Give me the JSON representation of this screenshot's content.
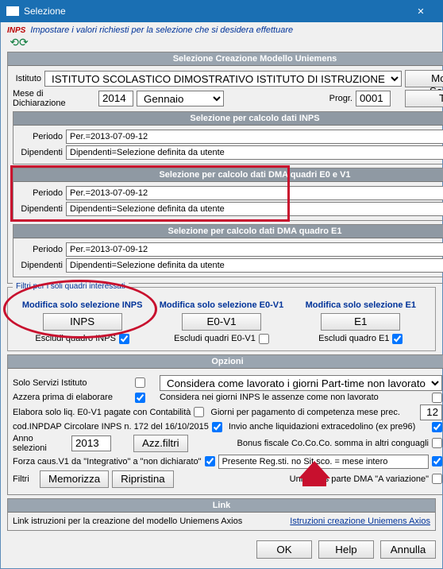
{
  "window": {
    "title": "Selezione"
  },
  "info": {
    "inps": "INPS",
    "text": "Impostare i valori richiesti per la selezione che si desidera effettuare"
  },
  "sec_creazione": {
    "header": "Selezione Creazione Modello Uniemens",
    "istituto_label": "Istituto",
    "istituto_value": "ISTITUTO SCOLASTICO DIMOSTRATIVO ISTITUTO DI ISTRUZIONE",
    "mod_sel_btn": "Modifica Selezioni",
    "mese_label": "Mese di Dichiarazione",
    "anno": "2014",
    "mese": "Gennaio",
    "progr_label": "Progr.",
    "progr": "0001",
    "tutte_btn": "Tutte"
  },
  "sec_inps": {
    "header": "Selezione per calcolo dati INPS",
    "periodo_label": "Periodo",
    "periodo_value": "Per.=2013-07-09-12",
    "dip_label": "Dipendenti",
    "dip_value": "Dipendenti=Selezione definita da utente"
  },
  "sec_e0v1": {
    "header": "Selezione per calcolo dati DMA quadri E0 e V1",
    "periodo_label": "Periodo",
    "periodo_value": "Per.=2013-07-09-12",
    "dip_label": "Dipendenti",
    "dip_value": "Dipendenti=Selezione definita da utente"
  },
  "sec_e1": {
    "header": "Selezione per calcolo dati DMA quadro E1",
    "periodo_label": "Periodo",
    "periodo_value": "Per.=2013-07-09-12",
    "dip_label": "Dipendenti",
    "dip_value": "Dipendenti=Selezione definita da utente"
  },
  "filtri": {
    "legend": "Filtri per i soli quadri interessati",
    "col1_head": "Modifica solo selezione INPS",
    "col1_btn": "INPS",
    "col1_excl": "Escludi quadro INPS",
    "col2_head": "Modifica solo selezione E0-V1",
    "col2_btn": "E0-V1",
    "col2_excl": "Escludi quadri E0-V1",
    "col3_head": "Modifica solo selezione E1",
    "col3_btn": "E1",
    "col3_excl": "Escludi quadro E1"
  },
  "opzioni": {
    "header": "Opzioni",
    "solo_serv": "Solo Servizi Istituto",
    "considera_pt": "Considera come lavorato i giorni Part-time non lavorato",
    "azzera": "Azzera prima di elaborare",
    "considera_inps": "Considera nei giorni INPS  le assenze come non lavorato",
    "elabora": "Elabora solo liq. E0-V1 pagate con Contabilità",
    "giorni_pag": "Giorni per pagamento di competenza mese prec.",
    "giorni_val": "12",
    "cod_inpdap": "cod.INPDAP Circolare INPS n. 172 del 16/10/2015",
    "invio_liq": "Invio anche liquidazioni extracedolino (ex pre96)",
    "anno_sel_label": "Anno selezioni",
    "anno_sel": "2013",
    "azz_filtri": "Azz.filtri",
    "bonus": "Bonus fiscale Co.Co.Co. somma in altri conguagli",
    "forza": "Forza caus.V1 da \"Integrativo\" a \"non dichiarato\"",
    "presente": "Presente Reg.sti. no Sit.sco. = mese intero",
    "filtri_label": "Filtri",
    "memorizza": "Memorizza",
    "ripristina": "Ripristina",
    "uniemens_parte": "Uniemens parte DMA \"A variazione\""
  },
  "link": {
    "header": "Link",
    "text": "Link istruzioni per la creazione del modello Uniemens Axios",
    "url_text": "Istruzioni creazione Uniemens Axios"
  },
  "buttons": {
    "ok": "OK",
    "help": "Help",
    "annulla": "Annulla"
  }
}
